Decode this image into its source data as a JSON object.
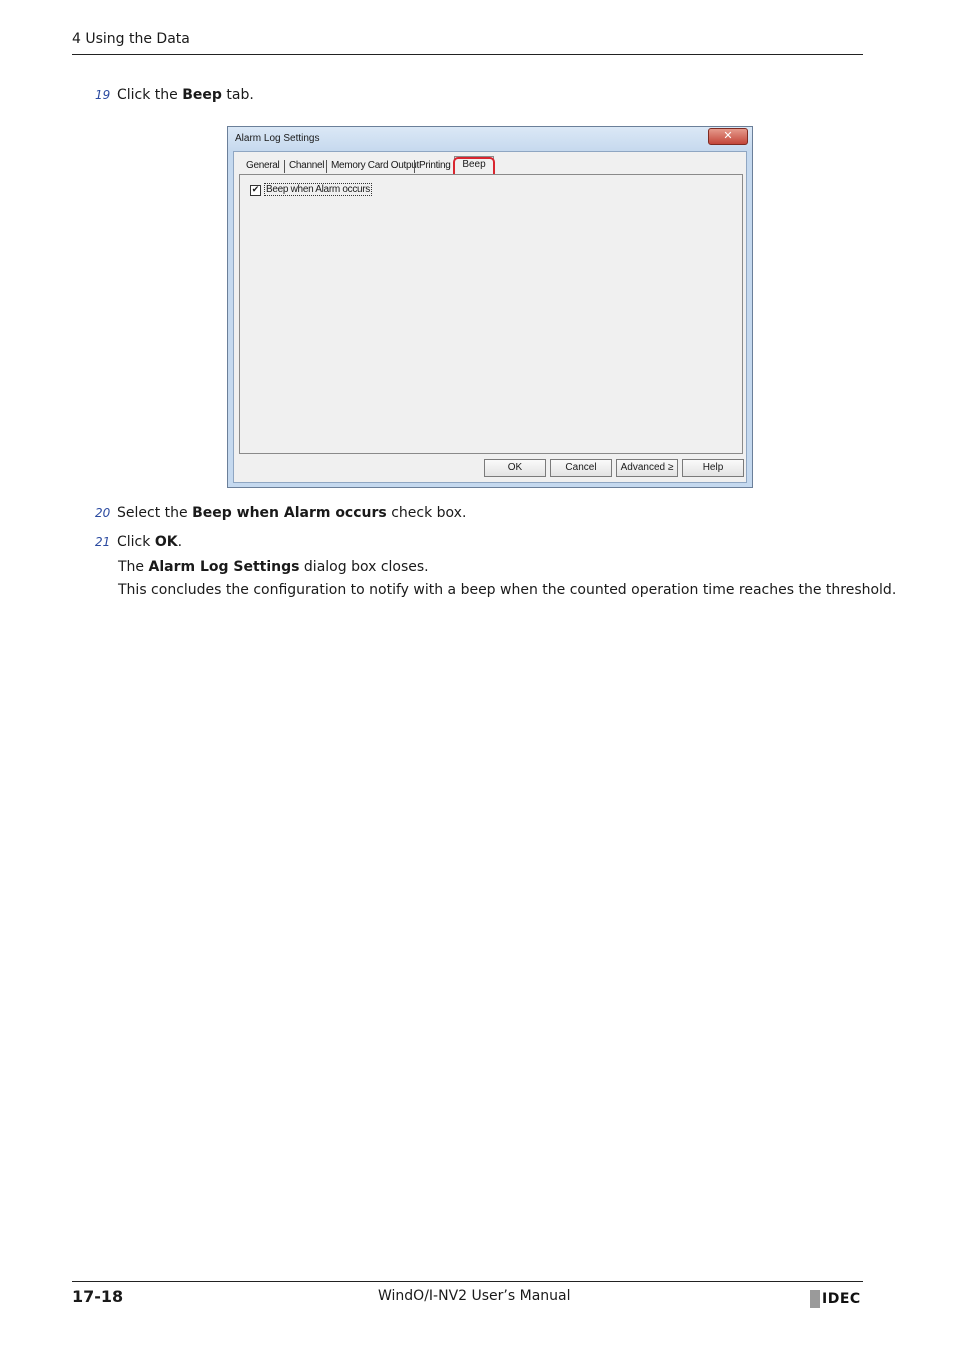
{
  "header": {
    "section_title": "4 Using the Data"
  },
  "steps": [
    {
      "num": "19",
      "pre": "Click the ",
      "bold": "Beep",
      "post": " tab."
    },
    {
      "num": "20",
      "pre": "Select the ",
      "bold": "Beep when Alarm occurs",
      "post": " check box."
    },
    {
      "num": "21",
      "pre": "Click ",
      "bold": "OK",
      "post": "."
    }
  ],
  "notes": [
    {
      "pre": "The ",
      "bold": "Alarm Log Settings",
      "post": " dialog box closes."
    },
    {
      "text": "This concludes the configuration to notify with a beep when the counted operation time reaches the threshold."
    }
  ],
  "dialog": {
    "title": "Alarm Log Settings",
    "close_glyph": "✕",
    "tabs": [
      "General",
      "Channel",
      "Memory Card Output",
      "Printing",
      "Beep"
    ],
    "active_tab": "Beep",
    "checkbox": {
      "label": "Beep when Alarm occurs",
      "checked": true,
      "mark": "✔"
    },
    "buttons": {
      "ok": "OK",
      "cancel": "Cancel",
      "advanced": "Advanced ≥",
      "help": "Help"
    },
    "highlight_color": "#d9262f"
  },
  "footer": {
    "page_number": "17-18",
    "manual_title": "WindO/I-NV2 User’s Manual",
    "logo_text": "IDEC"
  }
}
